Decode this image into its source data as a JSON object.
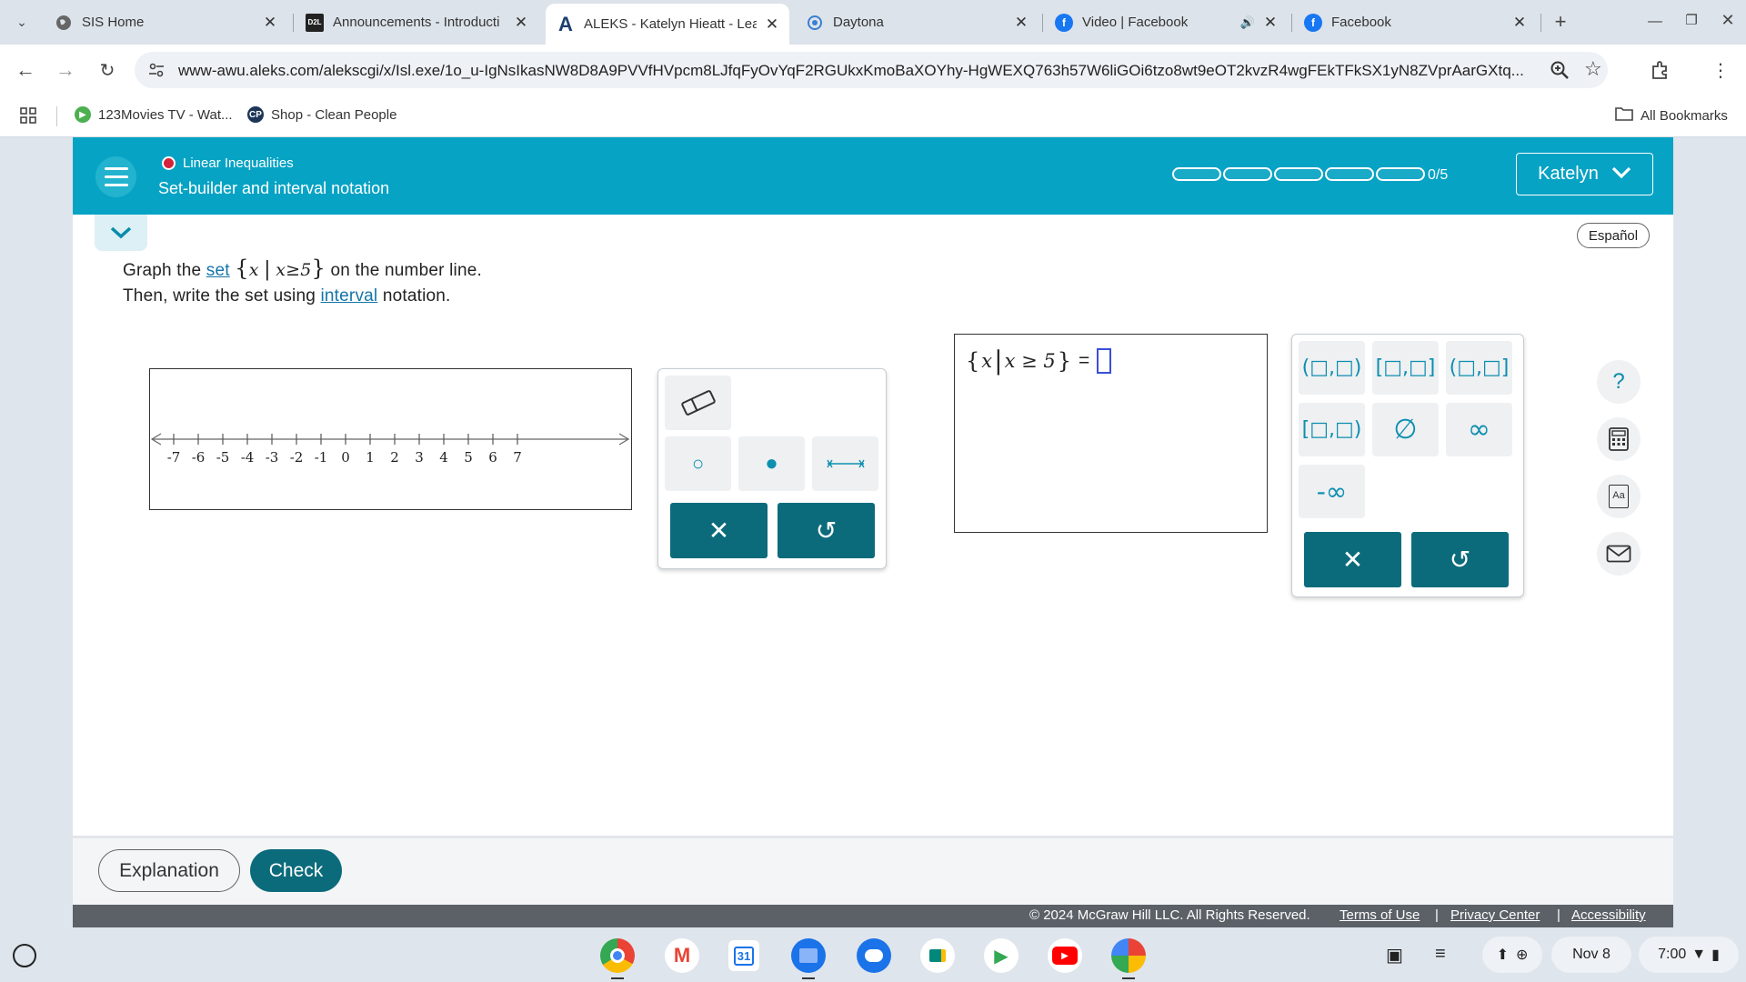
{
  "browser": {
    "tabs": [
      {
        "title": "SIS Home",
        "icon": "globe-icon",
        "closable": "✕"
      },
      {
        "title": "Announcements - Introducti",
        "icon": "d2l-icon",
        "icon_text": "D2L",
        "closable": "✕"
      },
      {
        "title": "ALEKS - Katelyn Hieatt - Lea",
        "icon": "aleks-a-icon",
        "icon_text": "A",
        "closable": "✕",
        "active": true
      },
      {
        "title": "Daytona",
        "icon": "daytona-icon",
        "closable": "✕"
      },
      {
        "title": "Video | Facebook",
        "icon": "facebook-icon",
        "icon_text": "f",
        "closable": "✕",
        "audio": "🔊"
      },
      {
        "title": "Facebook",
        "icon": "facebook-icon",
        "icon_text": "f",
        "closable": "✕"
      }
    ],
    "new_tab": "+",
    "url": "www-awu.aleks.com/alekscgi/x/Isl.exe/1o_u-IgNsIkasNW8D8A9PVVfHVpcm8LJfqFyOvYqF2RGUkxKmoBaXOYhy-HgWEXQ763h57W6liGOi6tzo8wt9eOT2kvzR4wgFEkTFkSX1yN8ZVprAarGXtq...",
    "bookmarks": [
      {
        "label": "123Movies TV - Wat...",
        "icon": "play-icon"
      },
      {
        "label": "Shop - Clean People",
        "icon": "cp-icon",
        "icon_text": "CP"
      }
    ],
    "all_bookmarks": "All Bookmarks"
  },
  "aleks": {
    "topic": "Linear Inequalities",
    "subtopic": "Set-builder and interval notation",
    "progress_text": "0/5",
    "progress_segments": 5,
    "progress_done": 0,
    "user": "Katelyn",
    "language_button": "Español",
    "prompt": {
      "line1_a": "Graph the ",
      "line1_link": "set",
      "set_open": "{",
      "set_var": "x",
      "set_bar": "|",
      "set_cond": "x≥5",
      "set_close": "}",
      "line1_b": " on the number line.",
      "line2_a": "Then, write the set using ",
      "line2_link": "interval",
      "line2_b": " notation."
    },
    "number_line": {
      "ticks": [
        "-7",
        "-6",
        "-5",
        "-4",
        "-3",
        "-2",
        "-1",
        "0",
        "1",
        "2",
        "3",
        "4",
        "5",
        "6",
        "7"
      ]
    },
    "graph_tools": {
      "eraser": "eraser-icon",
      "open_dot": "○",
      "closed_dot": "●",
      "segment": "segment-icon",
      "clear": "✕",
      "undo": "↺"
    },
    "answer": {
      "expr_open": "{",
      "expr_var": "x",
      "expr_bar": "|",
      "expr_cond": "x ≥ 5",
      "expr_close": "}",
      "expr_eq": "="
    },
    "interval_tools": {
      "open_open": "(□,□)",
      "closed_closed": "[□,□]",
      "open_closed": "(□,□]",
      "closed_open": "[□,□)",
      "empty_set": "∅",
      "infinity": "∞",
      "neg_infinity": "-∞",
      "clear": "✕",
      "undo": "↺"
    },
    "side_tools": {
      "help": "?",
      "calculator": "calculator-icon",
      "dictionary": "dictionary-icon",
      "dictionary_text": "Aa",
      "message": "envelope-icon"
    },
    "buttons": {
      "explanation": "Explanation",
      "check": "Check"
    },
    "footer": {
      "copyright": "© 2024 McGraw Hill LLC. All Rights Reserved.",
      "terms": "Terms of Use",
      "privacy": "Privacy Center",
      "accessibility": "Accessibility",
      "sep": "|"
    }
  },
  "shelf": {
    "date": "Nov 8",
    "time": "7:00",
    "calendar_day": "31",
    "launcher": "launcher-icon"
  }
}
